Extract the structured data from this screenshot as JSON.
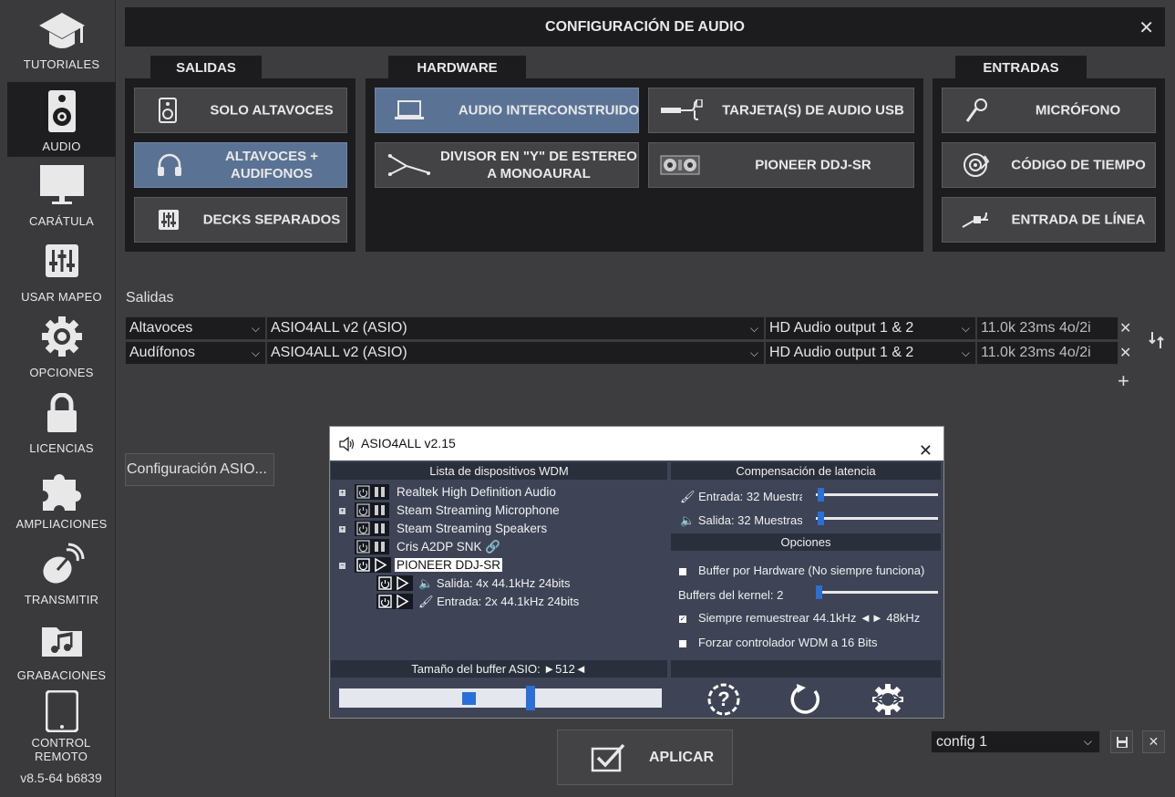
{
  "sidebar": {
    "items": [
      {
        "label": "TUTORIALES",
        "icon": "graduation-cap-icon"
      },
      {
        "label": "AUDIO",
        "icon": "speaker-icon"
      },
      {
        "label": "CARÁTULA",
        "icon": "monitor-icon"
      },
      {
        "label": "USAR MAPEO",
        "icon": "sliders-icon"
      },
      {
        "label": "OPCIONES",
        "icon": "gear-icon"
      },
      {
        "label": "LICENCIAS",
        "icon": "lock-icon"
      },
      {
        "label": "AMPLIACIONES",
        "icon": "puzzle-icon"
      },
      {
        "label": "TRANSMITIR",
        "icon": "satellite-dish-icon"
      },
      {
        "label": "GRABACIONES",
        "icon": "music-folder-icon"
      },
      {
        "label": "CONTROL REMOTO",
        "icon": "tablet-icon"
      }
    ],
    "active": "AUDIO",
    "version": "v8.5-64 b6839"
  },
  "window": {
    "title": "CONFIGURACIÓN DE AUDIO",
    "close": "✕"
  },
  "sections": {
    "salidas": {
      "title": "SALIDAS",
      "buttons": [
        "SOLO ALTAVOCES",
        "ALTAVOCES + AUDIFONOS",
        "DECKS SEPARADOS"
      ],
      "selected": "ALTAVOCES + AUDIFONOS"
    },
    "hardware": {
      "title": "HARDWARE",
      "buttons": [
        "AUDIO INTERCONSTRUIDO",
        "TARJETA(S) DE AUDIO USB",
        "DIVISOR EN \"Y\" DE ESTEREO A MONOAURAL",
        "PIONEER DDJ-SR"
      ],
      "selected": "AUDIO INTERCONSTRUIDO"
    },
    "entradas": {
      "title": "ENTRADAS",
      "buttons": [
        "MICRÓFONO",
        "CÓDIGO DE TIEMPO",
        "ENTRADA DE LÍNEA"
      ]
    }
  },
  "outputs": {
    "label": "Salidas",
    "rows": [
      {
        "channel": "Altavoces",
        "driver": "ASIO4ALL v2 (ASIO)",
        "port": "HD Audio output 1 & 2",
        "info": "11.0k 23ms 4o/2i"
      },
      {
        "channel": "Audífonos",
        "driver": "ASIO4ALL v2 (ASIO)",
        "port": "HD Audio output 1 & 2",
        "info": "11.0k 23ms 4o/2i"
      }
    ],
    "remove": "✕",
    "add": "+"
  },
  "asio_config_button": "Configuración ASIO...",
  "asio": {
    "title": "ASIO4ALL v2.15",
    "device_list_header": "Lista de dispositivos WDM",
    "devices": [
      {
        "name": "Realtek High Definition Audio",
        "expand": "+"
      },
      {
        "name": "Steam Streaming Microphone",
        "expand": "+"
      },
      {
        "name": "Steam Streaming Speakers",
        "expand": "+"
      },
      {
        "name": "Cris A2DP SNK",
        "expand": ""
      },
      {
        "name": "PIONEER DDJ-SR",
        "expand": "−"
      }
    ],
    "sub_devices": [
      {
        "name": "Salida: 4x 44.1kHz 24bits"
      },
      {
        "name": "Entrada: 2x 44.1kHz 24bits"
      }
    ],
    "latency_header": "Compensación de latencia",
    "latency_in": "Entrada: 32 Muestras",
    "latency_out": "Salida: 32 Muestras",
    "options_header": "Opciones",
    "opt_hw_buffer": "Buffer por Hardware (No siempre funciona)",
    "kernel_buffers": "Buffers del kernel: 2",
    "opt_resample": "Siempre remuestrear 44.1kHz ◄► 48kHz",
    "opt_16bit": "Forzar controlador WDM a 16 Bits",
    "buffer_size": "Tamaño del buffer ASIO: ►512◄"
  },
  "apply": "APLICAR",
  "config": {
    "selected": "config 1",
    "delete": "✕"
  },
  "colors": {
    "selected_button": "#5a7394",
    "panel": "#1c1c1e",
    "asio_bg": "#3e4455",
    "slider": "#2a6fd6"
  }
}
